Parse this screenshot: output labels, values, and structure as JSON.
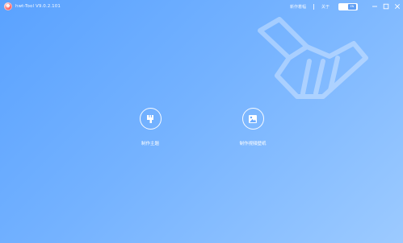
{
  "titlebar": {
    "app_title": "hwt-Tool V9.0.2.101",
    "links": {
      "whats_new": "新作着幅",
      "about": "关于"
    },
    "toggle_label": "EN",
    "window_buttons": {
      "minimize_icon": "minimize-icon",
      "maximize_icon": "maximize-icon",
      "close_icon": "close-icon"
    }
  },
  "background": {
    "decoration_icon": "broom-icon",
    "gradient_start": "#5aa2ff",
    "gradient_end": "#9ccaff"
  },
  "features": [
    {
      "label": "制作主題",
      "icon": "brush-icon"
    },
    {
      "label": "制作視頻壁纸",
      "icon": "video-wallpaper-icon"
    }
  ]
}
